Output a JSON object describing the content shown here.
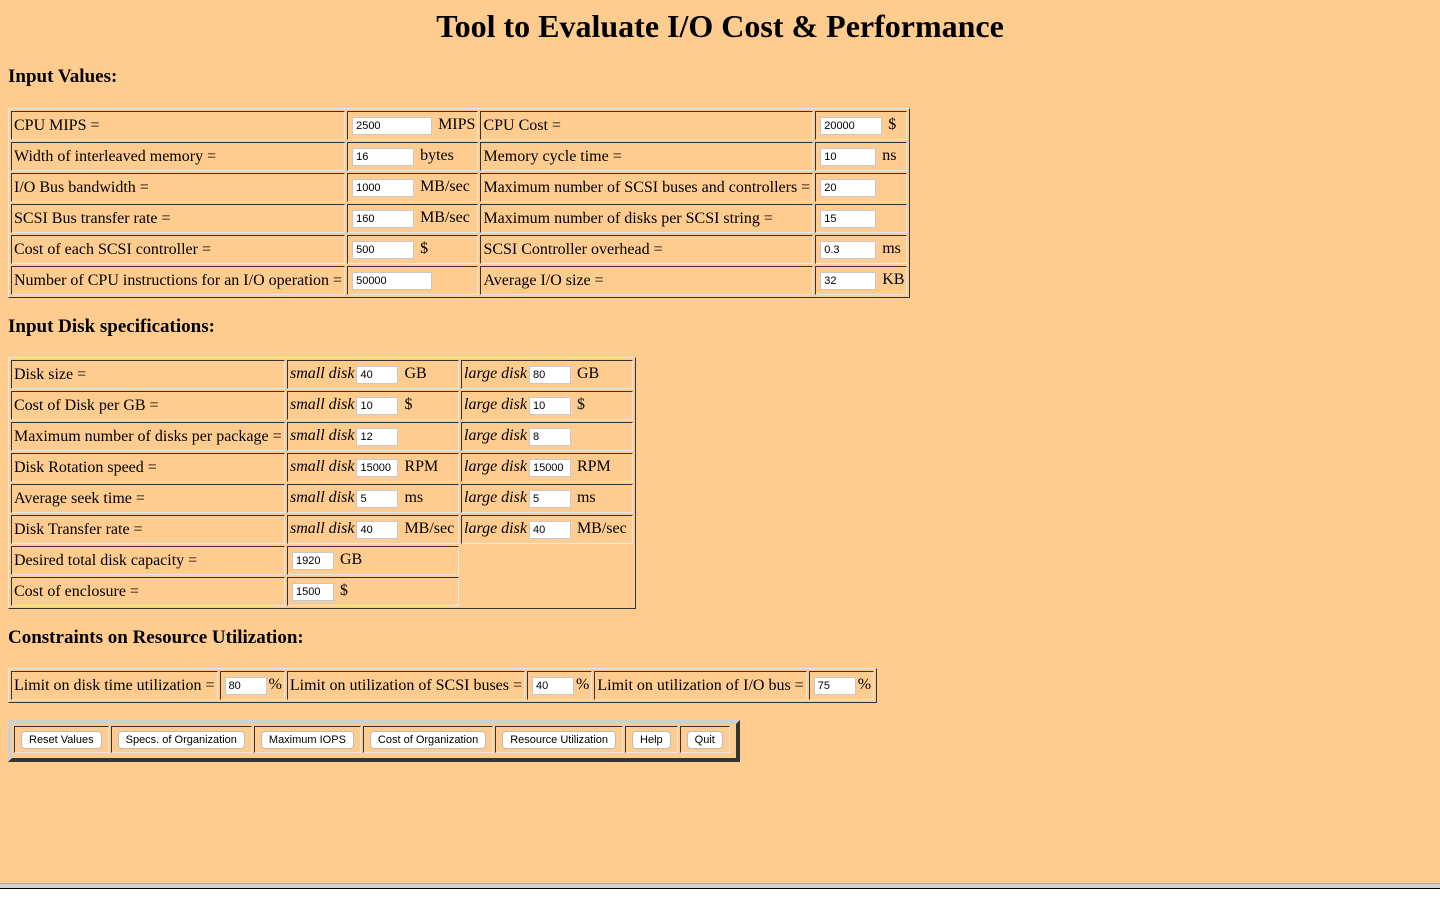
{
  "title": "Tool to Evaluate I/O Cost & Performance",
  "sections": {
    "input_values": "Input Values:",
    "disk_specs": "Input Disk specifications:",
    "constraints": "Constraints on Resource Utilization:"
  },
  "input_values": [
    {
      "left": {
        "label": "CPU MIPS =",
        "value": "2500",
        "unit": "MIPS"
      },
      "right": {
        "label": "CPU Cost =",
        "value": "20000",
        "unit": "$"
      }
    },
    {
      "left": {
        "label": "Width of interleaved memory =",
        "value": "16",
        "unit": "bytes"
      },
      "right": {
        "label": "Memory cycle time =",
        "value": "10",
        "unit": "ns"
      }
    },
    {
      "left": {
        "label": "I/O Bus bandwidth =",
        "value": "1000",
        "unit": "MB/sec"
      },
      "right": {
        "label": "Maximum number of SCSI buses and controllers =",
        "value": "20",
        "unit": ""
      }
    },
    {
      "left": {
        "label": "SCSI Bus transfer rate =",
        "value": "160",
        "unit": "MB/sec"
      },
      "right": {
        "label": "Maximum number of disks per SCSI string =",
        "value": "15",
        "unit": ""
      }
    },
    {
      "left": {
        "label": "Cost of each SCSI controller =",
        "value": "500",
        "unit": "$"
      },
      "right": {
        "label": "SCSI Controller overhead =",
        "value": "0.3",
        "unit": "ms"
      }
    },
    {
      "left": {
        "label": "Number of CPU instructions for an I/O operation =",
        "value": "50000",
        "unit": ""
      },
      "right": {
        "label": "Average I/O size =",
        "value": "32",
        "unit": "KB"
      }
    }
  ],
  "disk_specs": {
    "small_label": "small disk",
    "large_label": "large disk",
    "rows": [
      {
        "label": "Disk size =",
        "small": "40",
        "large": "80",
        "unit": "GB"
      },
      {
        "label": "Cost of Disk per GB =",
        "small": "10",
        "large": "10",
        "unit": "$"
      },
      {
        "label": "Maximum number of disks per package =",
        "small": "12",
        "large": "8",
        "unit": ""
      },
      {
        "label": "Disk Rotation speed =",
        "small": "15000",
        "large": "15000",
        "unit": "RPM"
      },
      {
        "label": "Average seek time =",
        "small": "5",
        "large": "5",
        "unit": "ms"
      },
      {
        "label": "Disk Transfer rate =",
        "small": "40",
        "large": "40",
        "unit": "MB/sec"
      }
    ],
    "capacity": {
      "label": "Desired total disk capacity =",
      "value": "1920",
      "unit": "GB"
    },
    "enclosure": {
      "label": "Cost of enclosure =",
      "value": "1500",
      "unit": "$"
    }
  },
  "constraints": [
    {
      "label": "Limit on disk time utilization =",
      "value": "80",
      "unit": "%"
    },
    {
      "label": "Limit on utilization of SCSI buses =",
      "value": "40",
      "unit": "%"
    },
    {
      "label": "Limit on utilization of I/O bus =",
      "value": "75",
      "unit": "%"
    }
  ],
  "buttons": {
    "reset": "Reset Values",
    "specs": "Specs. of Organization",
    "max_iops": "Maximum IOPS",
    "cost": "Cost of Organization",
    "resource": "Resource Utilization",
    "help": "Help",
    "quit": "Quit"
  }
}
